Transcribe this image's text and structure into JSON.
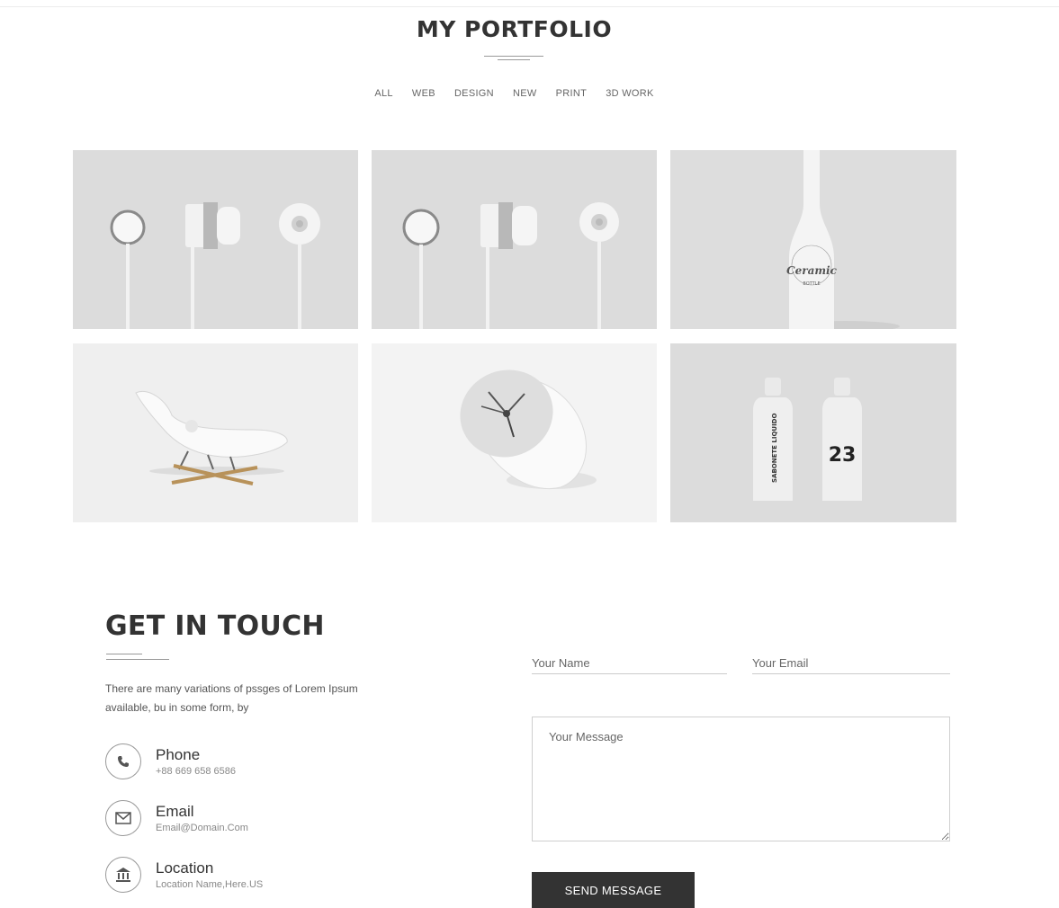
{
  "portfolio": {
    "title": "MY PORTFOLIO",
    "filters": [
      "ALL",
      "WEB",
      "DESIGN",
      "NEW",
      "PRINT",
      "3D WORK"
    ],
    "items": [
      {
        "name": "earphones",
        "icon": "earphones-image"
      },
      {
        "name": "earphones-2",
        "icon": "earphones-image"
      },
      {
        "name": "ceramic-bottle",
        "icon": "bottle-image"
      },
      {
        "name": "lounge-chair",
        "icon": "chair-image"
      },
      {
        "name": "desk-clock",
        "icon": "clock-image"
      },
      {
        "name": "liquid-bottles",
        "icon": "bottles-image"
      }
    ]
  },
  "contact": {
    "title": "GET IN TOUCH",
    "description": "There are many variations of pssges of Lorem Ipsum available, bu in some form, by",
    "items": [
      {
        "label": "Phone",
        "value": "+88 669 658 6586",
        "icon": "phone-icon"
      },
      {
        "label": "Email",
        "value": "Email@Domain.Com",
        "icon": "envelope-icon"
      },
      {
        "label": "Location",
        "value": "Location Name,Here.US",
        "icon": "bank-icon"
      }
    ],
    "form": {
      "name_placeholder": "Your Name",
      "email_placeholder": "Your Email",
      "message_placeholder": "Your Message",
      "submit_label": "SEND MESSAGE"
    }
  },
  "artwork_text": {
    "bottle_label": "Ceramic",
    "bottle_sub": "BOTTLE",
    "sabonete": "SABONETE LIQUIDO",
    "number": "23"
  }
}
